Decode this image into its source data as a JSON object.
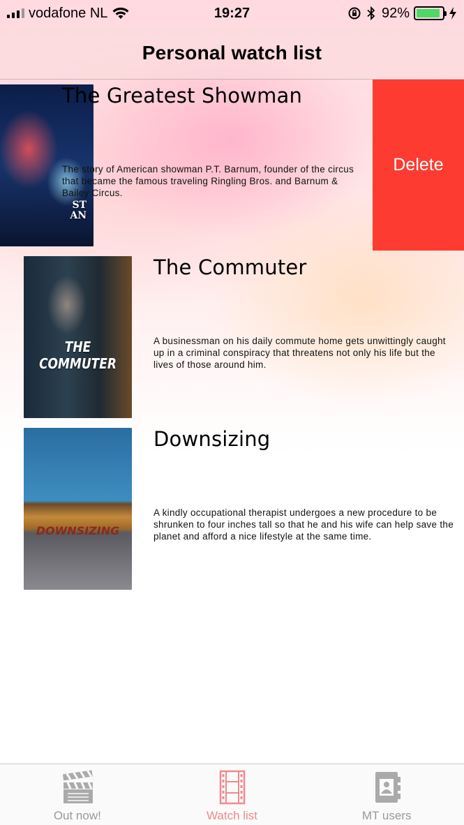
{
  "status_bar": {
    "carrier": "vodafone NL",
    "time": "19:27",
    "battery": "92%",
    "battery_level": 0.92
  },
  "nav": {
    "title": "Personal watch list"
  },
  "movies": [
    {
      "title": "The Greatest Showman",
      "description": "The story of American showman P.T. Barnum, founder of the circus that became the famous traveling Ringling Bros. and Barnum & Bailey Circus.",
      "poster_text": "ST\nAN",
      "delete_label": "Delete"
    },
    {
      "title": "The Commuter",
      "description": "A businessman on his daily commute home gets unwittingly caught up in a criminal conspiracy that threatens not only his life but the lives of those around him.",
      "poster_text": "THE COMMUTER"
    },
    {
      "title": "Downsizing",
      "description": "A kindly occupational therapist undergoes a new procedure to be shrunken to four inches tall so that he and his wife can help save the planet and afford a nice lifestyle at the same time.",
      "poster_text": "DOWNSIZING"
    }
  ],
  "tabs": [
    {
      "label": "Out now!",
      "icon": "clapperboard-icon",
      "active": false
    },
    {
      "label": "Watch list",
      "icon": "film-strip-icon",
      "active": true
    },
    {
      "label": "MT users",
      "icon": "contacts-book-icon",
      "active": false
    }
  ],
  "colors": {
    "delete": "#fd3b30",
    "tab_active": "#f08a8a",
    "tab_inactive": "#999999",
    "battery": "#4cd964"
  }
}
